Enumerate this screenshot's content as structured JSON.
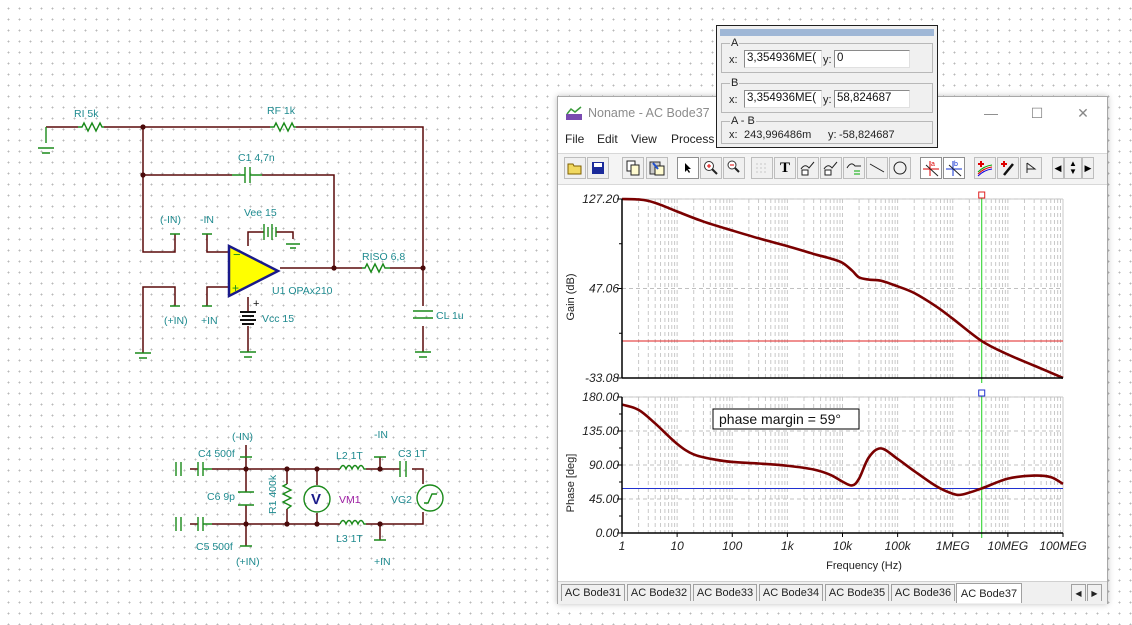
{
  "schematic": {
    "components": [
      {
        "id": "RI",
        "label": "RI 5k"
      },
      {
        "id": "RF",
        "label": "RF 1k"
      },
      {
        "id": "C1",
        "label": "C1 4,7n"
      },
      {
        "id": "Vee",
        "label": "Vee 15"
      },
      {
        "id": "Vcc",
        "label": "Vcc 15"
      },
      {
        "id": "U1",
        "label": "U1 OPAx210"
      },
      {
        "id": "RISO",
        "label": "RISO 6,8"
      },
      {
        "id": "CL",
        "label": "CL 1u"
      },
      {
        "id": "C4",
        "label": "C4 500f"
      },
      {
        "id": "C5",
        "label": "C5 500f"
      },
      {
        "id": "C6",
        "label": "C6 9p"
      },
      {
        "id": "R1",
        "label": "R1 400k"
      },
      {
        "id": "VM1",
        "label": "VM1"
      },
      {
        "id": "L2",
        "label": "L2 1T"
      },
      {
        "id": "L3",
        "label": "L3 1T"
      },
      {
        "id": "C3",
        "label": "C3 1T"
      },
      {
        "id": "VG2",
        "label": "VG2"
      }
    ],
    "net_labels": {
      "neg_in_paren_top": "(-IN)",
      "neg_in_top": "-IN",
      "pos_in_paren_top": "(+IN)",
      "pos_in_top": "+IN",
      "neg_in_paren_bot": "(-IN)",
      "neg_in_bot": "-IN",
      "pos_in_paren_bot": "(+IN)",
      "pos_in_bot": "+IN"
    },
    "meter_glyph": "V"
  },
  "cursor_panel": {
    "a": {
      "title": "A",
      "x_label": "x:",
      "x": "3,354936ME(",
      "y_label": "y:",
      "y": "0"
    },
    "b": {
      "title": "B",
      "x_label": "x:",
      "x": "3,354936ME(",
      "y_label": "y:",
      "y": "58,824687"
    },
    "diff": {
      "title": "A - B",
      "x_label": "x:",
      "x": "243,996486m",
      "y_label": "y:",
      "y": "-58,824687"
    }
  },
  "window": {
    "title": "Noname - AC Bode37",
    "controls": {
      "minimize": "—",
      "maximize": "☐",
      "close": "✕"
    },
    "menu": [
      "File",
      "Edit",
      "View",
      "Process"
    ],
    "toolbar": [
      {
        "name": "open-icon"
      },
      {
        "name": "save-icon"
      },
      {
        "name": "copy-icon"
      },
      {
        "name": "paste-icon"
      },
      {
        "name": "select-arrow-icon",
        "active": true
      },
      {
        "name": "zoom-in-icon"
      },
      {
        "name": "zoom-100-icon"
      },
      {
        "name": "grid-icon"
      },
      {
        "name": "text-icon"
      },
      {
        "name": "annotate-icon"
      },
      {
        "name": "annotate-query-icon"
      },
      {
        "name": "curve-label-icon"
      },
      {
        "name": "line-icon"
      },
      {
        "name": "circle-icon"
      },
      {
        "name": "cursor-a-icon",
        "active": true
      },
      {
        "name": "cursor-b-icon",
        "active": true
      },
      {
        "name": "add-curve-icon"
      },
      {
        "name": "pick-icon"
      },
      {
        "name": "marker-icon"
      },
      {
        "name": "nav-left-icon"
      },
      {
        "name": "nav-updown-icon"
      },
      {
        "name": "nav-right-icon"
      }
    ],
    "tabs": [
      "AC Bode31",
      "AC Bode32",
      "AC Bode33",
      "AC Bode34",
      "AC Bode35",
      "AC Bode36",
      "AC Bode37"
    ],
    "active_tab": "AC Bode37",
    "colors": {
      "trace": "#7a0000",
      "cursor_a": "#e02020",
      "cursor_b": "#2030d0",
      "cursor_x": "#20d020"
    }
  },
  "chart_data": [
    {
      "type": "line",
      "ylabel": "Gain (dB)",
      "xscale": "log",
      "xlim": [
        1,
        100000000
      ],
      "ylim": [
        -33.08,
        127.2
      ],
      "yticks": [
        "127.20",
        "47.06",
        "-33.08"
      ],
      "cursor_x": 3354936,
      "cursor_y": 0,
      "series": [
        {
          "name": "Gain",
          "x": [
            1,
            2,
            3,
            5,
            10,
            30,
            100,
            300,
            1000,
            3000,
            6000,
            10000,
            15000,
            20000,
            30000,
            50000,
            100000,
            200000,
            500000,
            1000000,
            3354936,
            10000000,
            30000000,
            100000000
          ],
          "y": [
            127.2,
            126.8,
            125.5,
            122,
            116,
            107,
            99,
            92,
            85,
            78,
            74,
            70,
            63,
            57,
            55,
            54,
            49,
            43,
            31,
            20,
            0,
            -12,
            -22,
            -33
          ]
        }
      ]
    },
    {
      "type": "line",
      "ylabel": "Phase [deg]",
      "xlabel": "Frequency (Hz)",
      "xscale": "log",
      "xlim": [
        1,
        100000000
      ],
      "ylim": [
        0,
        180
      ],
      "yticks": [
        "180.00",
        "135.00",
        "90.00",
        "45.00",
        "0.00"
      ],
      "xticks": [
        "1",
        "10",
        "100",
        "1k",
        "10k",
        "100k",
        "1MEG",
        "10MEG",
        "100MEG"
      ],
      "cursor_x": 3354936,
      "cursor_y": 58.82,
      "annotation": "phase margin = 59°",
      "series": [
        {
          "name": "Phase",
          "x": [
            1,
            2,
            4,
            10,
            20,
            50,
            100,
            300,
            1000,
            3000,
            6000,
            10000,
            15000,
            20000,
            30000,
            50000,
            100000,
            200000,
            500000,
            1000000,
            1500000,
            3354936,
            10000000,
            30000000,
            60000000,
            100000000
          ],
          "y": [
            170,
            163,
            145,
            118,
            104,
            97,
            94,
            92,
            89,
            84,
            77,
            68,
            63,
            72,
            100,
            112,
            98,
            82,
            62,
            52,
            51,
            59,
            72,
            76,
            74,
            65
          ]
        }
      ]
    }
  ]
}
